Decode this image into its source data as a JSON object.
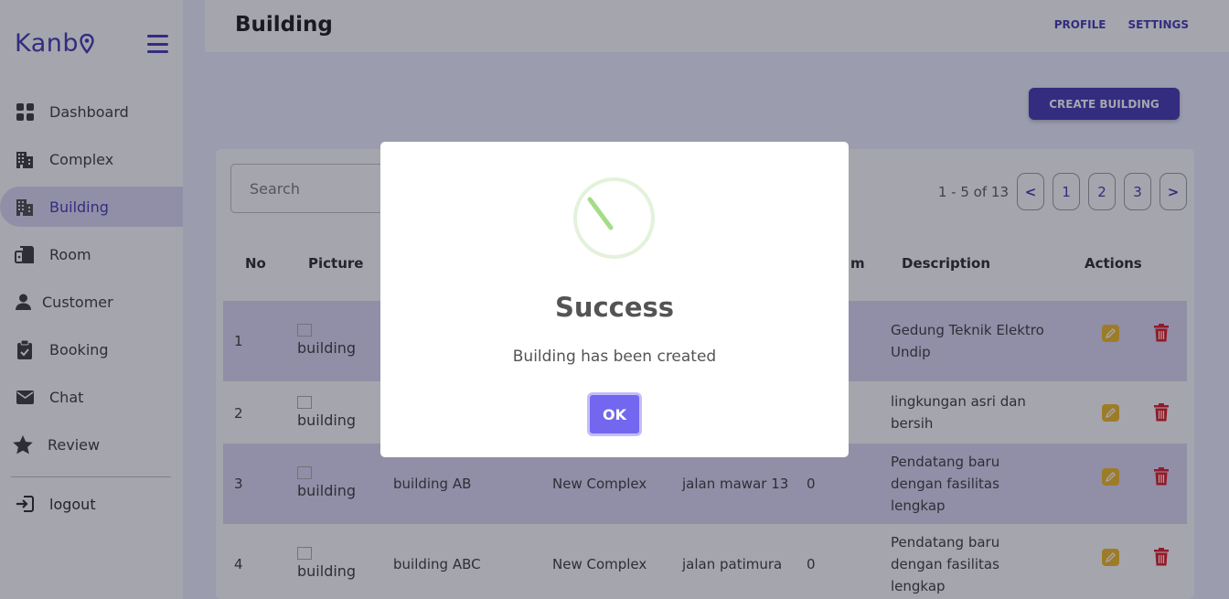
{
  "sidebar": {
    "logo": "Kanb",
    "items": [
      {
        "label": "Dashboard",
        "icon": "dashboard-icon"
      },
      {
        "label": "Complex",
        "icon": "building-icon"
      },
      {
        "label": "Building",
        "icon": "building-icon",
        "active": true
      },
      {
        "label": "Room",
        "icon": "room-icon"
      },
      {
        "label": "Customer",
        "icon": "person-icon"
      },
      {
        "label": "Booking",
        "icon": "clipboard-icon"
      },
      {
        "label": "Chat",
        "icon": "mail-icon"
      },
      {
        "label": "Review",
        "icon": "star-icon"
      }
    ],
    "logout": "logout"
  },
  "header": {
    "title": "Building",
    "profile": "PROFILE",
    "settings": "SETTINGS"
  },
  "toolbar": {
    "create_label": "CREATE BUILDING"
  },
  "search": {
    "placeholder": "Search"
  },
  "pagination": {
    "info": "1 - 5 of 13",
    "prev": "<",
    "pages": [
      "1",
      "2",
      "3"
    ],
    "next": ">"
  },
  "table": {
    "headers": {
      "no": "No",
      "picture": "Picture",
      "m": "m",
      "description": "Description",
      "actions": "Actions"
    },
    "rows": [
      {
        "no": "1",
        "picture_alt": "building",
        "name": "",
        "complex": "",
        "address": "",
        "m": "",
        "description": "Gedung Teknik Elektro Undip"
      },
      {
        "no": "2",
        "picture_alt": "building",
        "name": "",
        "complex": "",
        "address": "",
        "m": "",
        "description": "lingkungan asri dan bersih"
      },
      {
        "no": "3",
        "picture_alt": "building",
        "name": "building AB",
        "complex": "New Complex",
        "address": "jalan mawar 13",
        "m": "0",
        "description": "Pendatang baru dengan fasilitas lengkap"
      },
      {
        "no": "4",
        "picture_alt": "building",
        "name": "building ABC",
        "complex": "New Complex",
        "address": "jalan patimura",
        "m": "0",
        "description": "Pendatang baru dengan fasilitas lengkap"
      }
    ]
  },
  "modal": {
    "title": "Success",
    "message": "Building has been created",
    "ok_label": "OK"
  },
  "colors": {
    "brand": "#3b2fb0",
    "active_bg": "#dcdaf5",
    "edit": "#f2b81c",
    "delete": "#e0101a",
    "ok": "#7367f0",
    "success": "#a5dc86"
  }
}
